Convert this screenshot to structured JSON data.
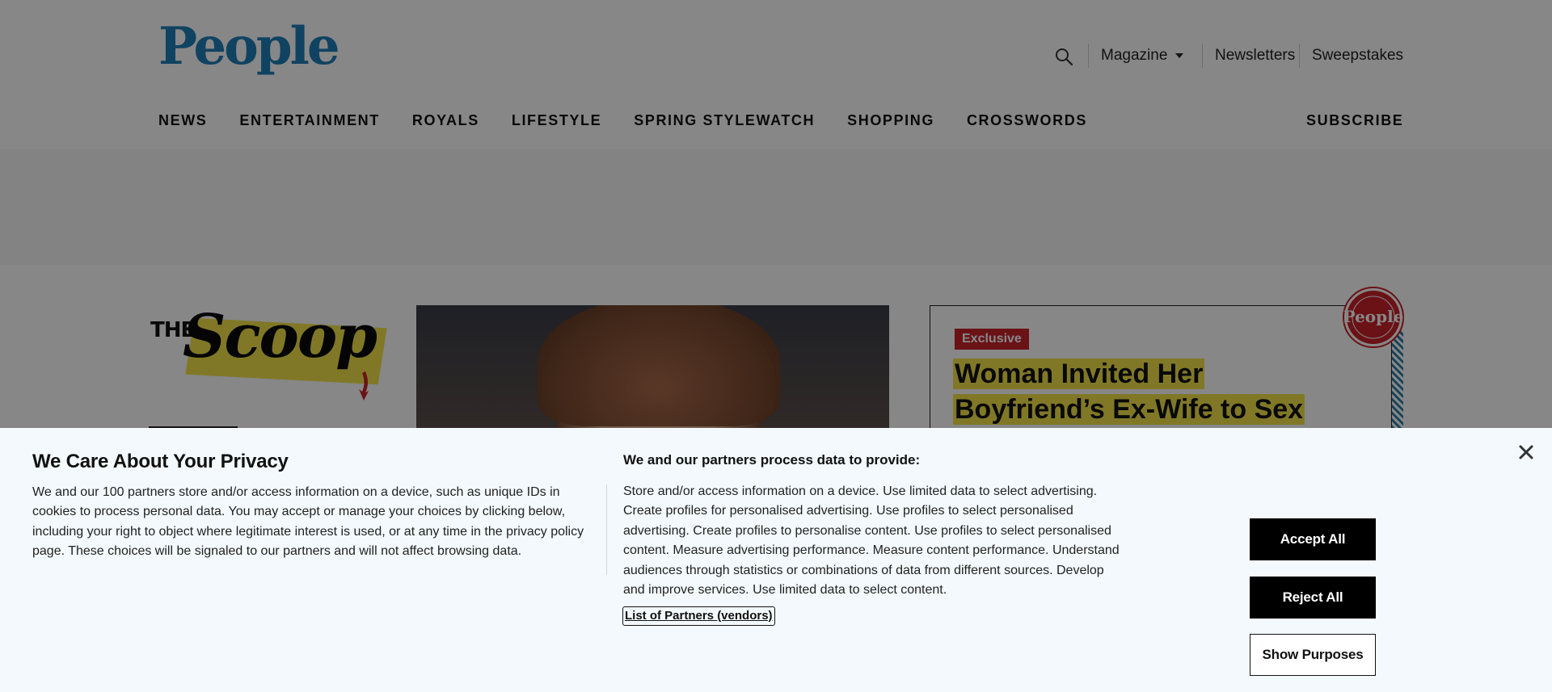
{
  "header": {
    "logo_text": "People",
    "links": {
      "magazine": "Magazine",
      "newsletters": "Newsletters",
      "sweepstakes": "Sweepstakes"
    },
    "nav": [
      "NEWS",
      "ENTERTAINMENT",
      "ROYALS",
      "LIFESTYLE",
      "SPRING STYLEWATCH",
      "SHOPPING",
      "CROSSWORDS"
    ],
    "subscribe": "SUBSCRIBE",
    "brand_color": "#1f7fb8"
  },
  "content": {
    "scoop_the": "THE",
    "scoop_word": "Scoop",
    "exclusive_badge": "Exclusive",
    "headline": "Woman Invited Her Boyfriend’s Ex-Wife to Sex",
    "seal_text": "People",
    "accent_color": "#c8222b",
    "highlight_color": "#f3e34a"
  },
  "privacy": {
    "title": "We Care About Your Privacy",
    "body": "We and our 100 partners store and/or access information on a device, such as unique IDs in cookies to process personal data. You may accept or manage your choices by clicking below, including your right to object where legitimate interest is used, or at any time in the privacy policy page. These choices will be signaled to our partners and will not affect browsing data.",
    "purposes_title": "We and our partners process data to provide:",
    "purposes_body": "Store and/or access information on a device. Use limited data to select advertising. Create profiles for personalised advertising. Use profiles to select personalised advertising. Create profiles to personalise content. Use profiles to select personalised content. Measure advertising performance. Measure content performance. Understand audiences through statistics or combinations of data from different sources. Develop and improve services. Use limited data to select content.",
    "vendors_link": "List of Partners (vendors)",
    "accept_all": "Accept All",
    "reject_all": "Reject All",
    "show_purposes": "Show Purposes"
  }
}
